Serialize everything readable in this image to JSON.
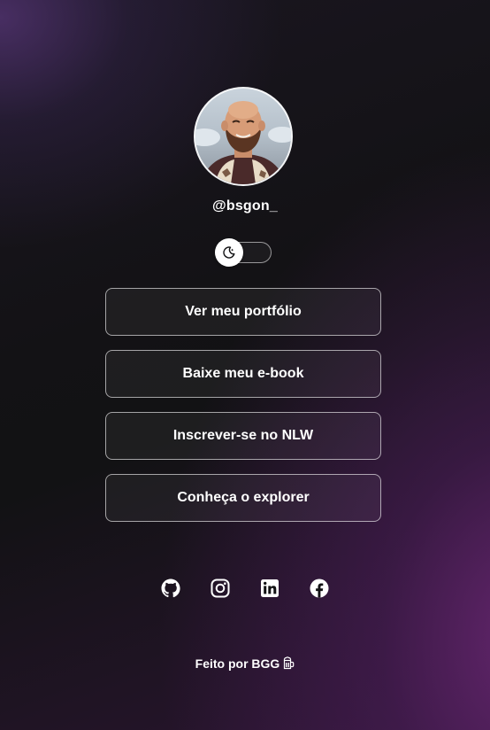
{
  "profile": {
    "handle": "@bsgon_",
    "avatar_icon": "avatar-illustration"
  },
  "theme_switch": {
    "icon": "moon-icon",
    "mode": "dark"
  },
  "links": [
    {
      "label": "Ver meu portfólio"
    },
    {
      "label": "Baixe meu e-book"
    },
    {
      "label": "Inscrever-se no NLW"
    },
    {
      "label": "Conheça o explorer"
    }
  ],
  "social": [
    {
      "name": "github-icon"
    },
    {
      "name": "instagram-icon"
    },
    {
      "name": "linkedin-icon"
    },
    {
      "name": "facebook-icon"
    }
  ],
  "footer": {
    "text": "Feito por BGG",
    "icon": "beer-mug-icon"
  },
  "colors": {
    "background": "#121214",
    "accent_purple": "#6e2878",
    "text": "#ffffff"
  }
}
